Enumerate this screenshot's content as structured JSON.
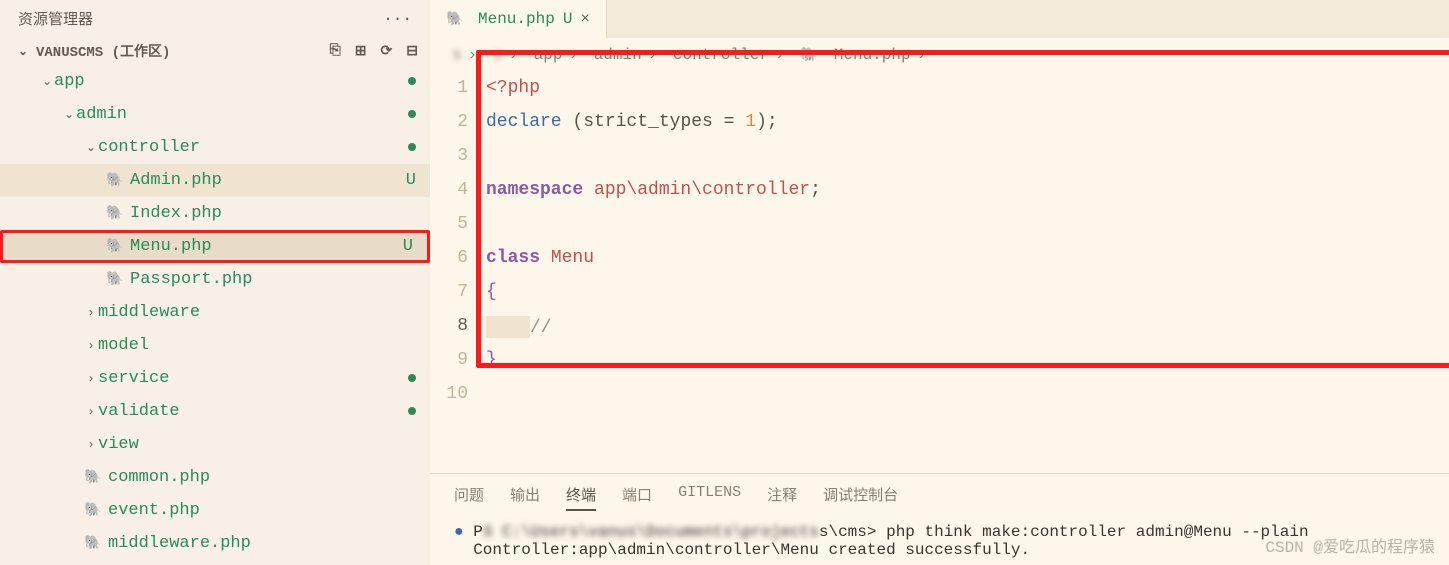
{
  "sidebar": {
    "title": "资源管理器",
    "workspace": "VANUSCMS (工作区)",
    "tree": {
      "app": "app",
      "admin": "admin",
      "controller": "controller",
      "files": {
        "admin": "Admin.php",
        "index": "Index.php",
        "menu": "Menu.php",
        "passport": "Passport.php"
      },
      "folders": {
        "middleware": "middleware",
        "model": "model",
        "service": "service",
        "validate": "validate",
        "view": "view"
      },
      "appFiles": {
        "common": "common.php",
        "event": "event.php",
        "middleware": "middleware.php"
      }
    },
    "git": {
      "u": "U"
    }
  },
  "tab": {
    "label": "Menu.php",
    "modified": "U",
    "close": "×"
  },
  "breadcrumb": {
    "hidden1": "s",
    "hidden2": "s",
    "app": "app",
    "admin": "admin",
    "controller": "controller",
    "file": "Menu.php"
  },
  "code": {
    "lines": [
      "1",
      "2",
      "3",
      "4",
      "5",
      "6",
      "7",
      "8",
      "9",
      "10"
    ],
    "l1_open": "<?php",
    "l2_fn": "declare",
    "l2_rest": " (strict_types = ",
    "l2_num": "1",
    "l2_end": ");",
    "l4_ns": "namespace",
    "l4_path": " app\\admin\\controller",
    "l4_semi": ";",
    "l6_class": "class",
    "l6_name": " Menu",
    "l7": "{",
    "l8_cmt": "//",
    "l9": "}"
  },
  "terminal": {
    "tabs": {
      "problems": "问题",
      "output": "输出",
      "terminal": "终端",
      "ports": "端口",
      "gitlens": "GITLENS",
      "comments": "注释",
      "debug": "调试控制台"
    },
    "line1_prefix": "P",
    "line1_blurred": "S C:\\Users\\vanus\\",
    "line1_blurred2": "Documents\\projects",
    "line1_path": "s\\cms> ",
    "line1_cmd": "php think make:controller admin@Menu --plain",
    "line2": "Controller:app\\admin\\controller\\Menu created successfully."
  },
  "watermark": "CSDN @爱吃瓜的程序猿"
}
